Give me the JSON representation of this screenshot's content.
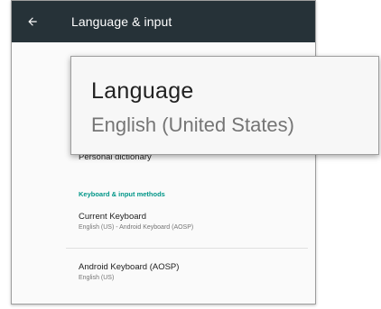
{
  "appbar": {
    "title": "Language & input",
    "back_icon": "arrow-left-icon"
  },
  "language_pref": {
    "title": "Language",
    "summary": "English (United States)"
  },
  "personal_dictionary": {
    "title": "Personal dictionary"
  },
  "keyboard_section": {
    "header": "Keyboard & input methods",
    "header_color": "#009688"
  },
  "current_keyboard": {
    "title": "Current Keyboard",
    "summary": "English (US) - Android Keyboard (AOSP)"
  },
  "android_keyboard": {
    "title": "Android Keyboard (AOSP)",
    "summary": "English (US)"
  },
  "colors": {
    "appbar_bg": "#263238",
    "accent": "#009688"
  }
}
